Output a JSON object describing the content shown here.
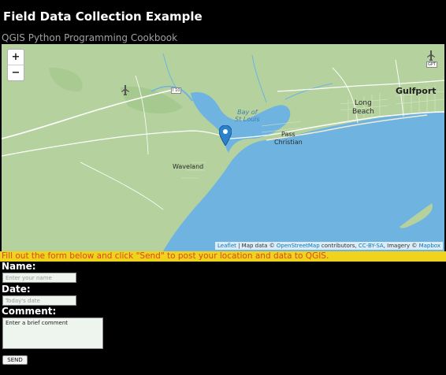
{
  "header": {
    "title": "Field Data Collection Example",
    "subtitle": "QGIS Python Programming Cookbook"
  },
  "map": {
    "zoom_in": "+",
    "zoom_out": "−",
    "labels": {
      "gulfport": "Gulfport",
      "long_beach": "Long\nBeach",
      "pass_christian": "Pass\nChristian",
      "waveland": "Waveland",
      "bay": "Bay of\nSt Louis",
      "hwy_shield": "I 10",
      "gpt": "GPT"
    },
    "attribution": {
      "leaflet": "Leaflet",
      "text1": " | Map data © ",
      "osm": "OpenStreetMap",
      "text2": " contributors, ",
      "license": "CC-BY-SA",
      "text3": ", Imagery © ",
      "mapbox": "Mapbox"
    },
    "marker_icon": "map-marker-icon"
  },
  "banner": {
    "text": "Fill out the form below and click \"Send\" to post your location and data to QGIS."
  },
  "form": {
    "name_label": "Name:",
    "name_placeholder": "Enter your name",
    "date_label": "Date:",
    "date_placeholder": "Today's date",
    "comment_label": "Comment:",
    "comment_placeholder": "Enter a brief comment",
    "send_label": "SEND"
  },
  "colors": {
    "land": "#b5d29e",
    "water": "#6fb3e0",
    "banner": "#f0d31c",
    "banner_text": "#d94a1c"
  }
}
